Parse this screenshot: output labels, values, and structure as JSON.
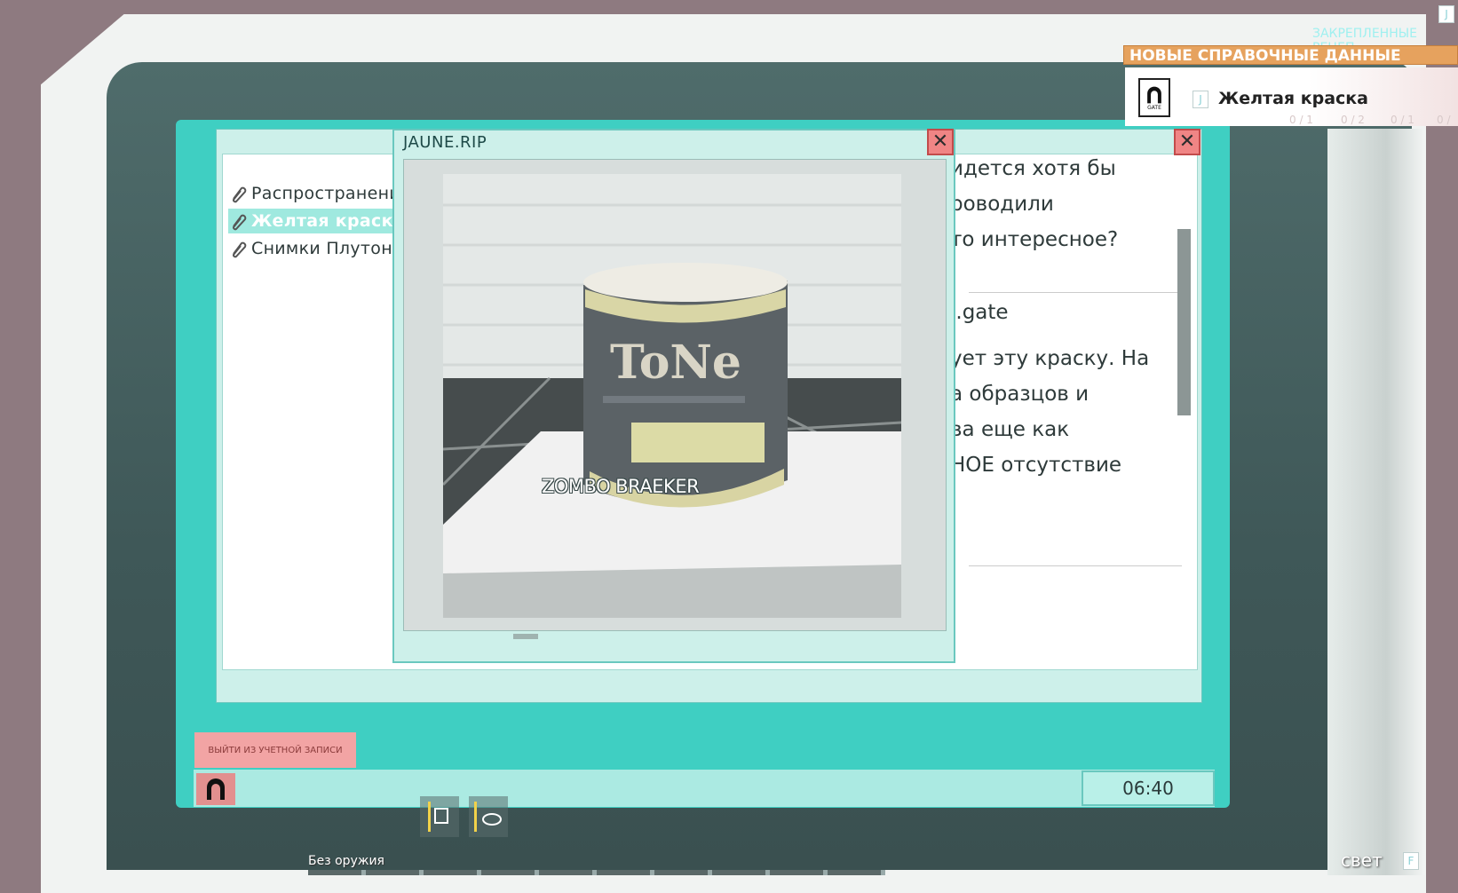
{
  "pinned_recipes": "ЗАКРЕПЛЕННЫЕ РЕЦЕП",
  "notification": {
    "header": "НОВЫЕ СПРАВОЧНЫЕ ДАННЫЕ",
    "item": "Желтая краска",
    "key_hint": "J",
    "icon_text": "GATE"
  },
  "top_key_hint": "J",
  "ghost_counts": [
    "0 / 1",
    "0 / 2",
    "0 / 1",
    "0 /"
  ],
  "main_window": {
    "list": [
      "Распространение",
      "Желтая краска",
      "Снимки Плутона"
    ],
    "selected_index": 1,
    "article_lines": [
      "идется хотя бы",
      "роводили",
      "то интересное?",
      "",
      "l.gate",
      "ует эту краску. На",
      "а образцов и",
      "ва еще как",
      "НОЕ отсутствие"
    ]
  },
  "image_window": {
    "title": "JAUNE.RIP",
    "can_label": "ToNe",
    "player_name": "ZOMBO BRAEKER"
  },
  "taskbar": {
    "logout": "ВЫЙТИ ИЗ УЧЕТНОЙ ЗАПИСИ",
    "clock": "06:40"
  },
  "hud": {
    "weapon_label": "Без оружия",
    "light_label": "свет",
    "light_key": "F"
  },
  "colors": {
    "screen": "#3fcfc2",
    "window": "#cdf0ea",
    "close": "#f08585",
    "notification_header": "#e6a25e",
    "logout": "#f2a4a4"
  }
}
